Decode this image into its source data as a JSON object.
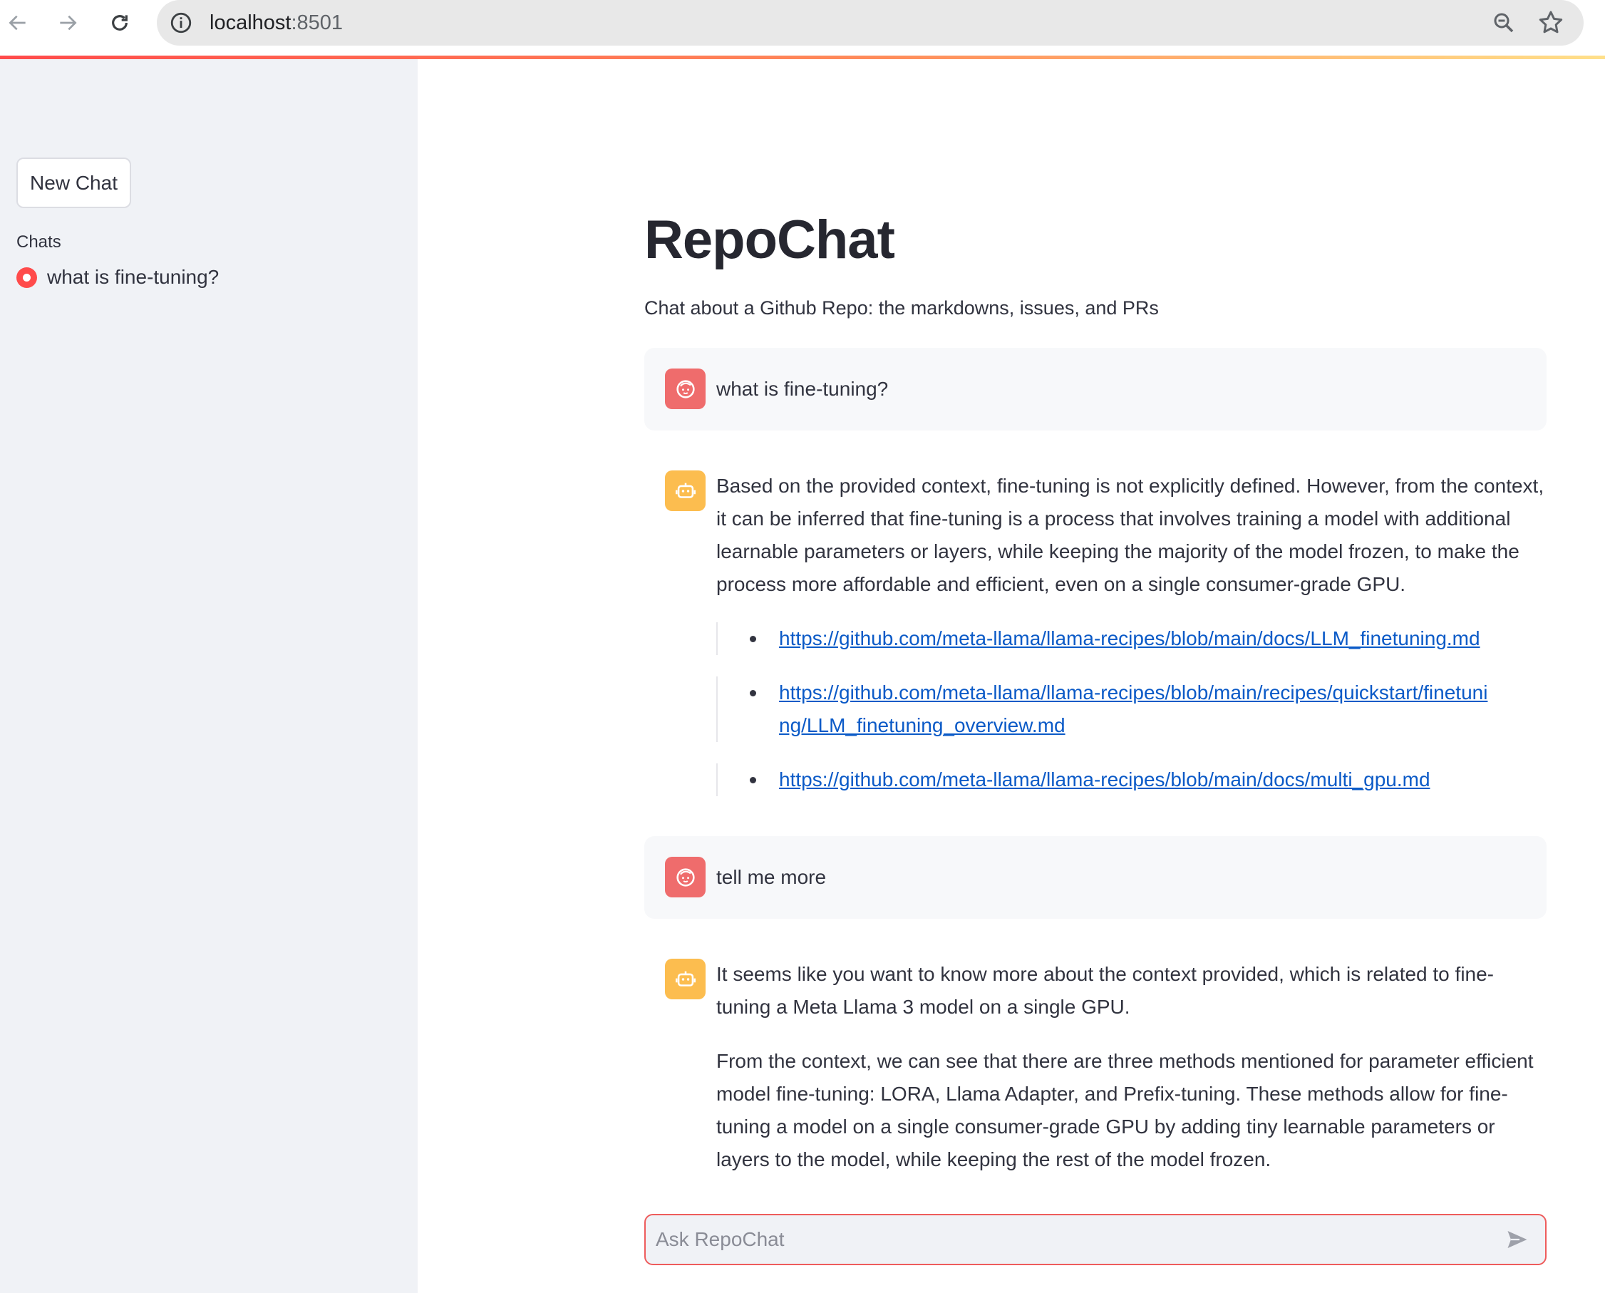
{
  "browser": {
    "url_host": "localhost",
    "url_port": ":8501"
  },
  "sidebar": {
    "new_chat_label": "New Chat",
    "chats_label": "Chats",
    "chats": [
      {
        "label": "what is fine-tuning?",
        "selected": true
      }
    ]
  },
  "main": {
    "title": "RepoChat",
    "subtitle": "Chat about a Github Repo: the markdowns, issues, and PRs",
    "messages": [
      {
        "role": "user",
        "text": "what is fine-tuning?"
      },
      {
        "role": "assistant",
        "text": "Based on the provided context, fine-tuning is not explicitly defined. However, from the context, it can be inferred that fine-tuning is a process that involves training a model with additional learnable parameters or layers, while keeping the majority of the model frozen, to make the process more affordable and efficient, even on a single consumer-grade GPU.",
        "links": [
          "https://github.com/meta-llama/llama-recipes/blob/main/docs/LLM_finetuning.md",
          "https://github.com/meta-llama/llama-recipes/blob/main/recipes/quickstart/finetuning/LLM_finetuning_overview.md",
          "https://github.com/meta-llama/llama-recipes/blob/main/docs/multi_gpu.md"
        ]
      },
      {
        "role": "user",
        "text": "tell me more"
      },
      {
        "role": "assistant",
        "paragraphs": [
          "It seems like you want to know more about the context provided, which is related to fine-tuning a Meta Llama 3 model on a single GPU.",
          "From the context, we can see that there are three methods mentioned for parameter efficient model fine-tuning: LORA, Llama Adapter, and Prefix-tuning. These methods allow for fine-tuning a model on a single consumer-grade GPU by adding tiny learnable parameters or layers to the model, while keeping the rest of the model frozen."
        ]
      }
    ],
    "input_placeholder": "Ask RepoChat"
  },
  "colors": {
    "accent": "#ff4b4b",
    "user_avatar": "#ef6c6c",
    "assistant_avatar": "#fcbd4f",
    "link": "#0b5ac7",
    "sidebar_bg": "#f0f2f6"
  },
  "icons": {
    "back": "arrow-left-icon",
    "forward": "arrow-right-icon",
    "reload": "reload-icon",
    "site_info": "info-icon",
    "zoom": "zoom-icon",
    "bookmark": "star-icon",
    "user_avatar": "face-icon",
    "assistant_avatar": "robot-icon",
    "send": "send-icon"
  }
}
